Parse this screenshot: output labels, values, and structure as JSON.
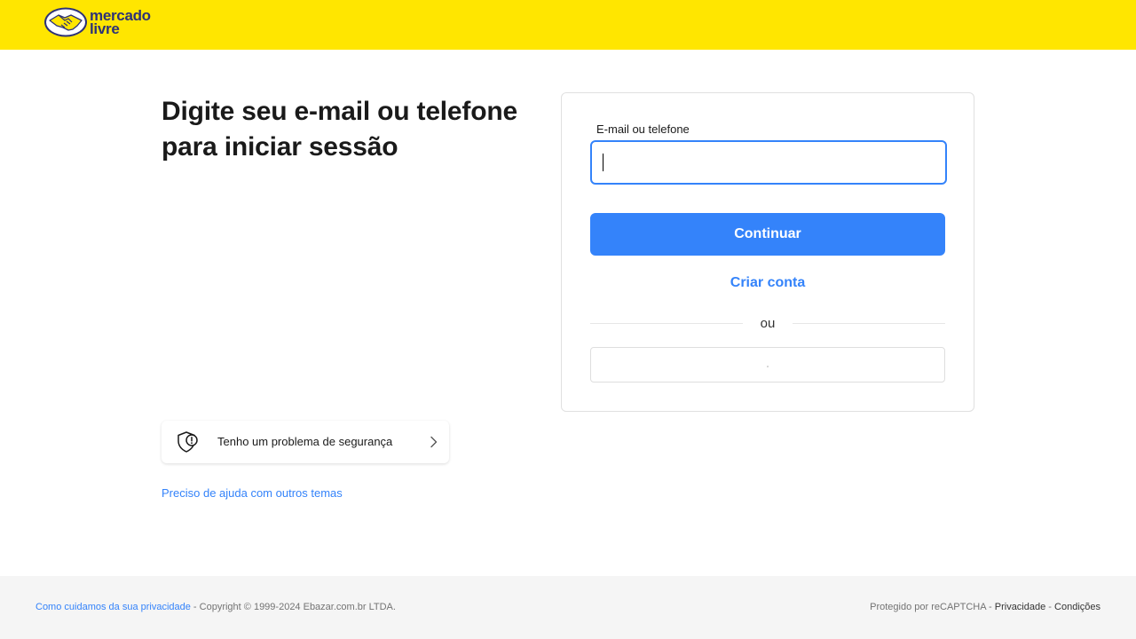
{
  "header": {
    "logo_line1": "mercado",
    "logo_line2": "livre",
    "color": "#ffe600"
  },
  "title": "Digite seu e-mail ou telefone para iniciar sessão",
  "login_form": {
    "field_label": "E-mail ou telefone",
    "field_value": "",
    "continue_label": "Continuar",
    "create_account_label": "Criar conta",
    "divider_text": "ou"
  },
  "security": {
    "label": "Tenho um problema de segurança",
    "icon": "shield-alert-icon"
  },
  "help_link": "Preciso de ajuda com outros temas",
  "footer": {
    "privacy_link": "Como cuidamos da sua privacidade",
    "copyright": " - Copyright © 1999-2024 Ebazar.com.br LTDA.",
    "recaptcha": "Protegido por reCAPTCHA - ",
    "privacy": "Privacidade",
    "separator": " - ",
    "terms": "Condições"
  },
  "colors": {
    "accent": "#3483fa",
    "brand_yellow": "#ffe600",
    "brand_navy": "#2d3277"
  }
}
